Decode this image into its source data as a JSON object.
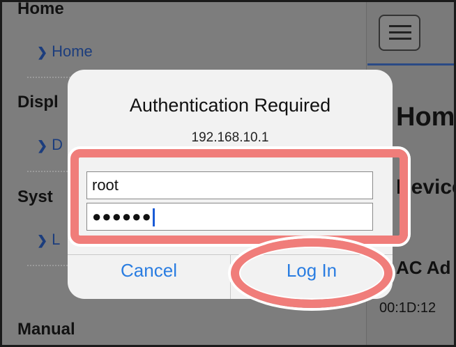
{
  "background": {
    "sections": [
      {
        "title": "Home",
        "link": "Home"
      },
      {
        "title": "Displ",
        "link": "D"
      },
      {
        "title": "Syst",
        "link": "L"
      },
      {
        "title": "Manual"
      }
    ],
    "right_pane": {
      "heading": "Home",
      "subheading": "Device",
      "row_label": "AC Ad",
      "row_value": "00:1D:12"
    }
  },
  "dialog": {
    "title": "Authentication Required",
    "host": "192.168.10.1",
    "username_value": "root",
    "password_mask": "●●●●●●",
    "cancel_label": "Cancel",
    "login_label": "Log In"
  },
  "colors": {
    "link_blue": "#2a7de1",
    "highlight": "#f07d7a",
    "nav_link": "#1c3d7d"
  },
  "icons": {
    "menu": "hamburger-menu-icon",
    "chevron": "chevron-right-icon"
  }
}
